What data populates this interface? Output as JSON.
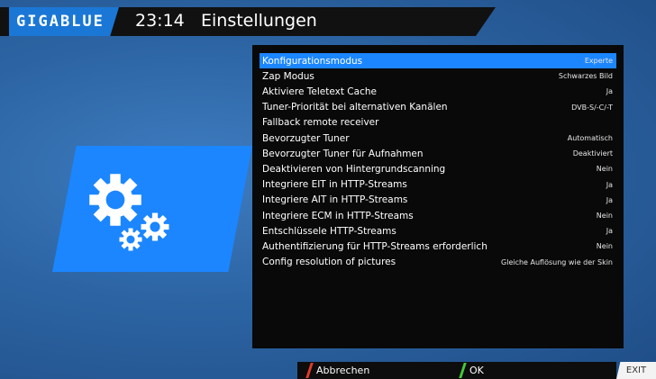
{
  "header": {
    "logo": "GIGABLUE",
    "clock": "23:14",
    "title": "Einstellungen"
  },
  "settings": [
    {
      "label": "Konfigurationsmodus",
      "value": "Experte",
      "selected": true
    },
    {
      "label": "Zap Modus",
      "value": "Schwarzes Bild"
    },
    {
      "label": "Aktiviere Teletext Cache",
      "value": "Ja"
    },
    {
      "label": "Tuner-Priorität bei alternativen Kanälen",
      "value": "DVB-S/-C/-T"
    },
    {
      "label": "Fallback remote receiver",
      "value": ""
    },
    {
      "label": "Bevorzugter Tuner",
      "value": "Automatisch"
    },
    {
      "label": "Bevorzugter Tuner für Aufnahmen",
      "value": "Deaktiviert"
    },
    {
      "label": "Deaktivieren von Hintergrundscanning",
      "value": "Nein"
    },
    {
      "label": "Integriere EIT in HTTP-Streams",
      "value": "Ja"
    },
    {
      "label": "Integriere AIT in HTTP-Streams",
      "value": "Ja"
    },
    {
      "label": "Integriere ECM in HTTP-Streams",
      "value": "Nein"
    },
    {
      "label": "Entschlüssele HTTP-Streams",
      "value": "Ja"
    },
    {
      "label": "Authentifizierung für HTTP-Streams erforderlich",
      "value": "Nein"
    },
    {
      "label": "Config resolution of pictures",
      "value": "Gleiche Auflösung wie der Skin"
    }
  ],
  "footer": {
    "cancel_label": "Abbrechen",
    "ok_label": "OK",
    "exit_label": "EXIT"
  },
  "colors": {
    "accent": "#1b86ff",
    "cancel_key": "#e23b2e",
    "ok_key": "#46c83c"
  },
  "icons": {
    "settings": "gears-icon"
  }
}
